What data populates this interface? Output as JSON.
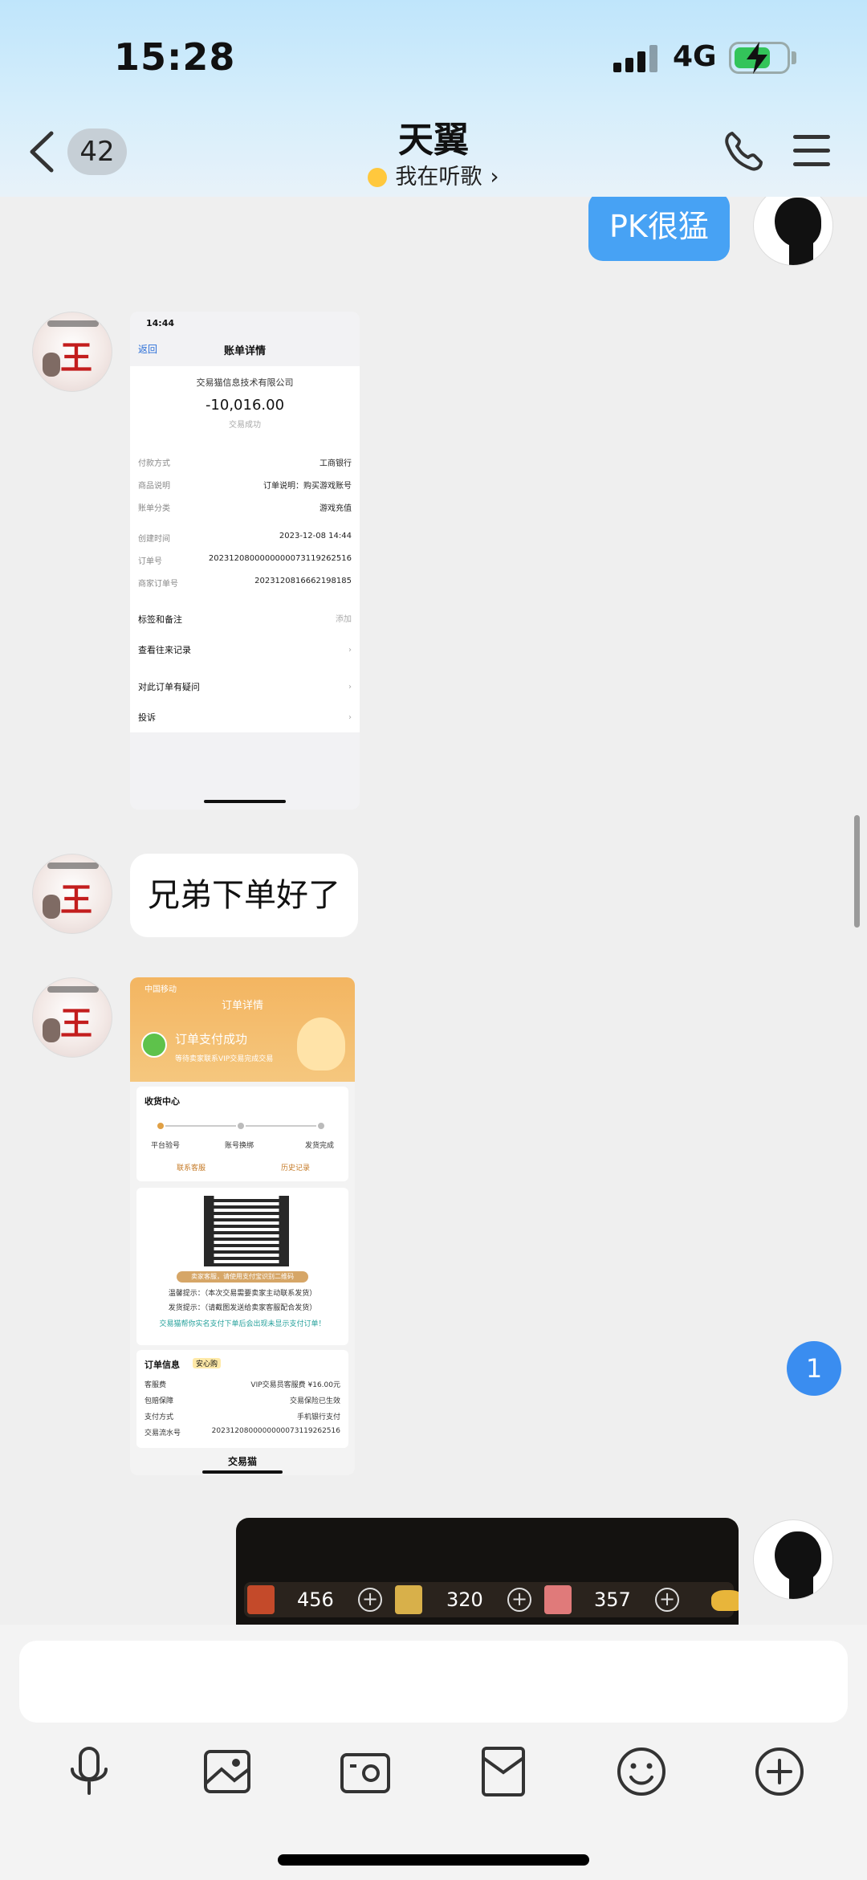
{
  "status_bar": {
    "time": "15:28",
    "network": "4G"
  },
  "nav": {
    "unread_count": "42",
    "title": "天翼",
    "subtitle": "我在听歌"
  },
  "messages": {
    "sent_text": "PK很猛",
    "received_text": "兄弟下单好了"
  },
  "bill_screenshot": {
    "time": "14:44",
    "back": "返回",
    "title": "账单详情",
    "merchant": "交易猫信息技术有限公司",
    "amount": "-10,016.00",
    "state": "交易成功",
    "rows": [
      {
        "key": "付款方式",
        "value": "工商银行"
      },
      {
        "key": "商品说明",
        "value": "订单说明：购买游戏账号"
      },
      {
        "key": "账单分类",
        "value": "游戏充值"
      },
      {
        "key": "创建时间",
        "value": "2023-12-08 14:44"
      },
      {
        "key": "订单号",
        "value": "2023120800000000073119262516"
      },
      {
        "key": "商家订单号",
        "value": "202312081666219818​5"
      }
    ],
    "cells": [
      {
        "label": "标签和备注",
        "right": "添加"
      },
      {
        "label": "查看往来记录",
        "right": ""
      },
      {
        "label": "对此订单有疑问",
        "right": ""
      },
      {
        "label": "投诉",
        "right": ""
      }
    ]
  },
  "order_screenshot": {
    "carrier": "中国移动",
    "title": "订单详情",
    "paid": "订单支付成功",
    "hint": "等待卖家联系VIP交易完成交易",
    "section_receive": "收货中心",
    "steps": [
      "平台验号",
      "账号换绑",
      "发货完成"
    ],
    "contact": "联系客服",
    "history": "历史记录",
    "qr_caption": "卖家客服，请使用支付宝识别二维码",
    "notice1": "温馨提示：（本次交易需要卖家主动联系发货）",
    "notice2": "发货提示：（请截图发送给卖家客服配合发货）",
    "notice3": "交易猫帮你实名支付下单后会出现未显示支付订单！",
    "info_title": "订单信息",
    "info_tag": "安心购",
    "rows": [
      {
        "key": "客服费",
        "value": "VIP交易员客服费 ¥16.00元"
      },
      {
        "key": "包赔保障",
        "value": "交易保险已生效"
      },
      {
        "key": "支付方式",
        "value": "手机银行支付"
      },
      {
        "key": "交易流水号",
        "value": "2023120800000000073119262516"
      }
    ],
    "brand": "交易猫"
  },
  "game_screenshot": {
    "values": [
      "456",
      "320",
      "357"
    ]
  },
  "new_message_badge": "1",
  "colors": {
    "sent_bubble": "#47a2f4",
    "badge": "#3a8df0",
    "header_top": "#bfe5fb"
  },
  "toolbar": [
    "microphone-icon",
    "image-icon",
    "camera-icon",
    "red-packet-icon",
    "emoji-icon",
    "plus-icon"
  ]
}
